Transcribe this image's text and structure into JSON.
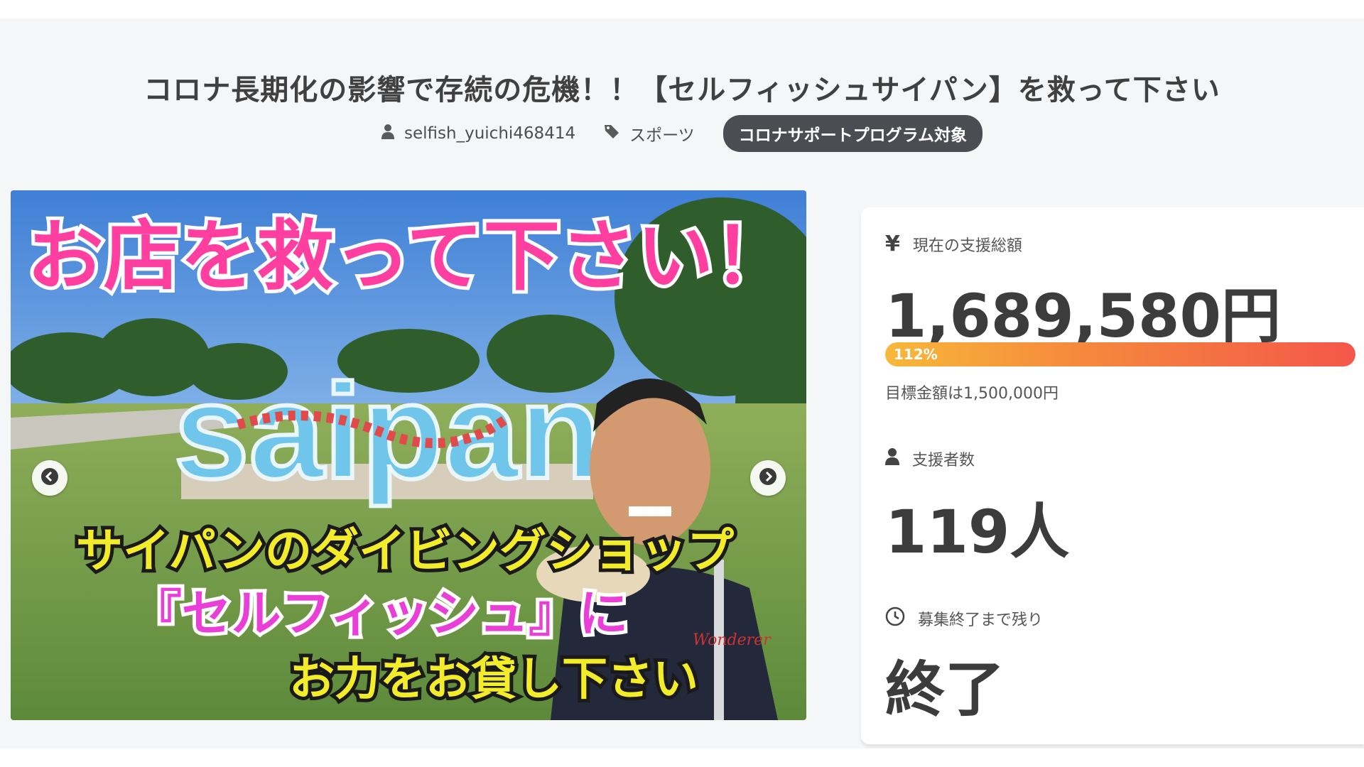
{
  "project": {
    "title": "コロナ長期化の影響で存続の危機！！【セルフィッシュサイパン】を救って下さい",
    "owner": "selfish_yuichi468414",
    "category": "スポーツ",
    "badge": "コロナサポートプログラム対象"
  },
  "image": {
    "headline": "お店を救って下さい！",
    "sign_text": "saipan",
    "caption_lines": [
      "サイパンのダイビングショップ",
      "『セルフィッシュ』に",
      "お力をお貸し下さい"
    ],
    "shirt_text": "Wonderer"
  },
  "stats": {
    "amount_label": "現在の支援総額",
    "amount_value": "1,689,580円",
    "progress_label": "112%",
    "progress_fraction": 1.0,
    "goal_text": "目標金額は1,500,000円",
    "supporters_label": "支援者数",
    "supporters_value": "119人",
    "remaining_label": "募集終了まで残り",
    "remaining_value": "終了"
  },
  "icons": {
    "currency": "yen-icon",
    "owner": "user-icon",
    "category": "tag-icon",
    "supporters": "user-icon",
    "remaining": "clock-icon",
    "prev": "chevron-left-icon",
    "next": "chevron-right-icon"
  },
  "colors": {
    "badge_bg": "#4a4d52",
    "progress_start": "#f8b83a",
    "progress_end": "#f4574a",
    "headline_fill": "#ff3fa0",
    "caption_fill": "#f2ec2a"
  }
}
